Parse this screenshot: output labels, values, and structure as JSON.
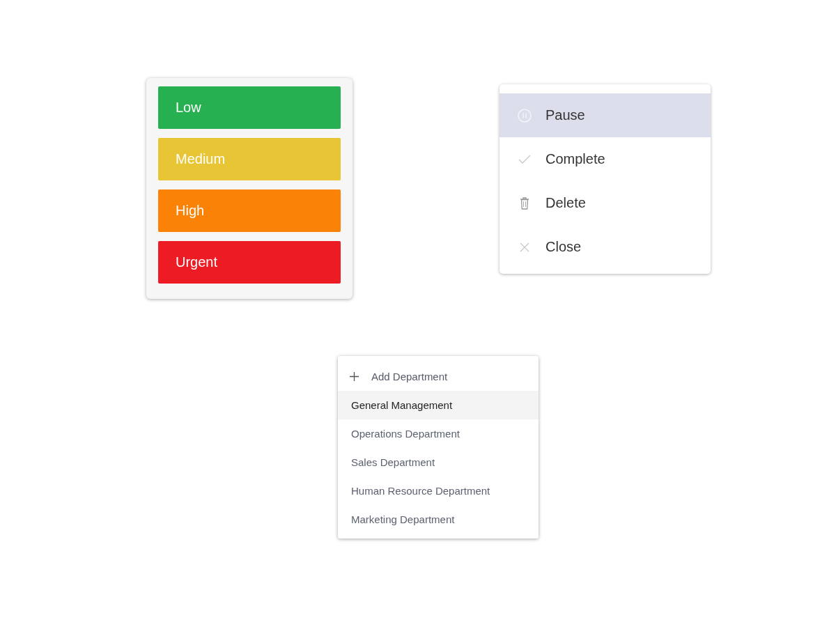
{
  "priority_menu": {
    "options": [
      {
        "label": "Low",
        "color": "#27b052"
      },
      {
        "label": "Medium",
        "color": "#e8c534"
      },
      {
        "label": "High",
        "color": "#f98207"
      },
      {
        "label": "Urgent",
        "color": "#ed1c24"
      }
    ]
  },
  "action_menu": {
    "items": [
      {
        "label": "Pause",
        "selected": true
      },
      {
        "label": "Complete",
        "selected": false
      },
      {
        "label": "Delete",
        "selected": false
      },
      {
        "label": "Close",
        "selected": false
      }
    ]
  },
  "department_menu": {
    "add_button": {
      "label": "Add Department"
    },
    "items": [
      {
        "label": "General Management",
        "selected": true
      },
      {
        "label": "Operations Department",
        "selected": false
      },
      {
        "label": "Sales Department",
        "selected": false
      },
      {
        "label": "Human Resource Department",
        "selected": false
      },
      {
        "label": "Marketing Department",
        "selected": false
      }
    ]
  }
}
